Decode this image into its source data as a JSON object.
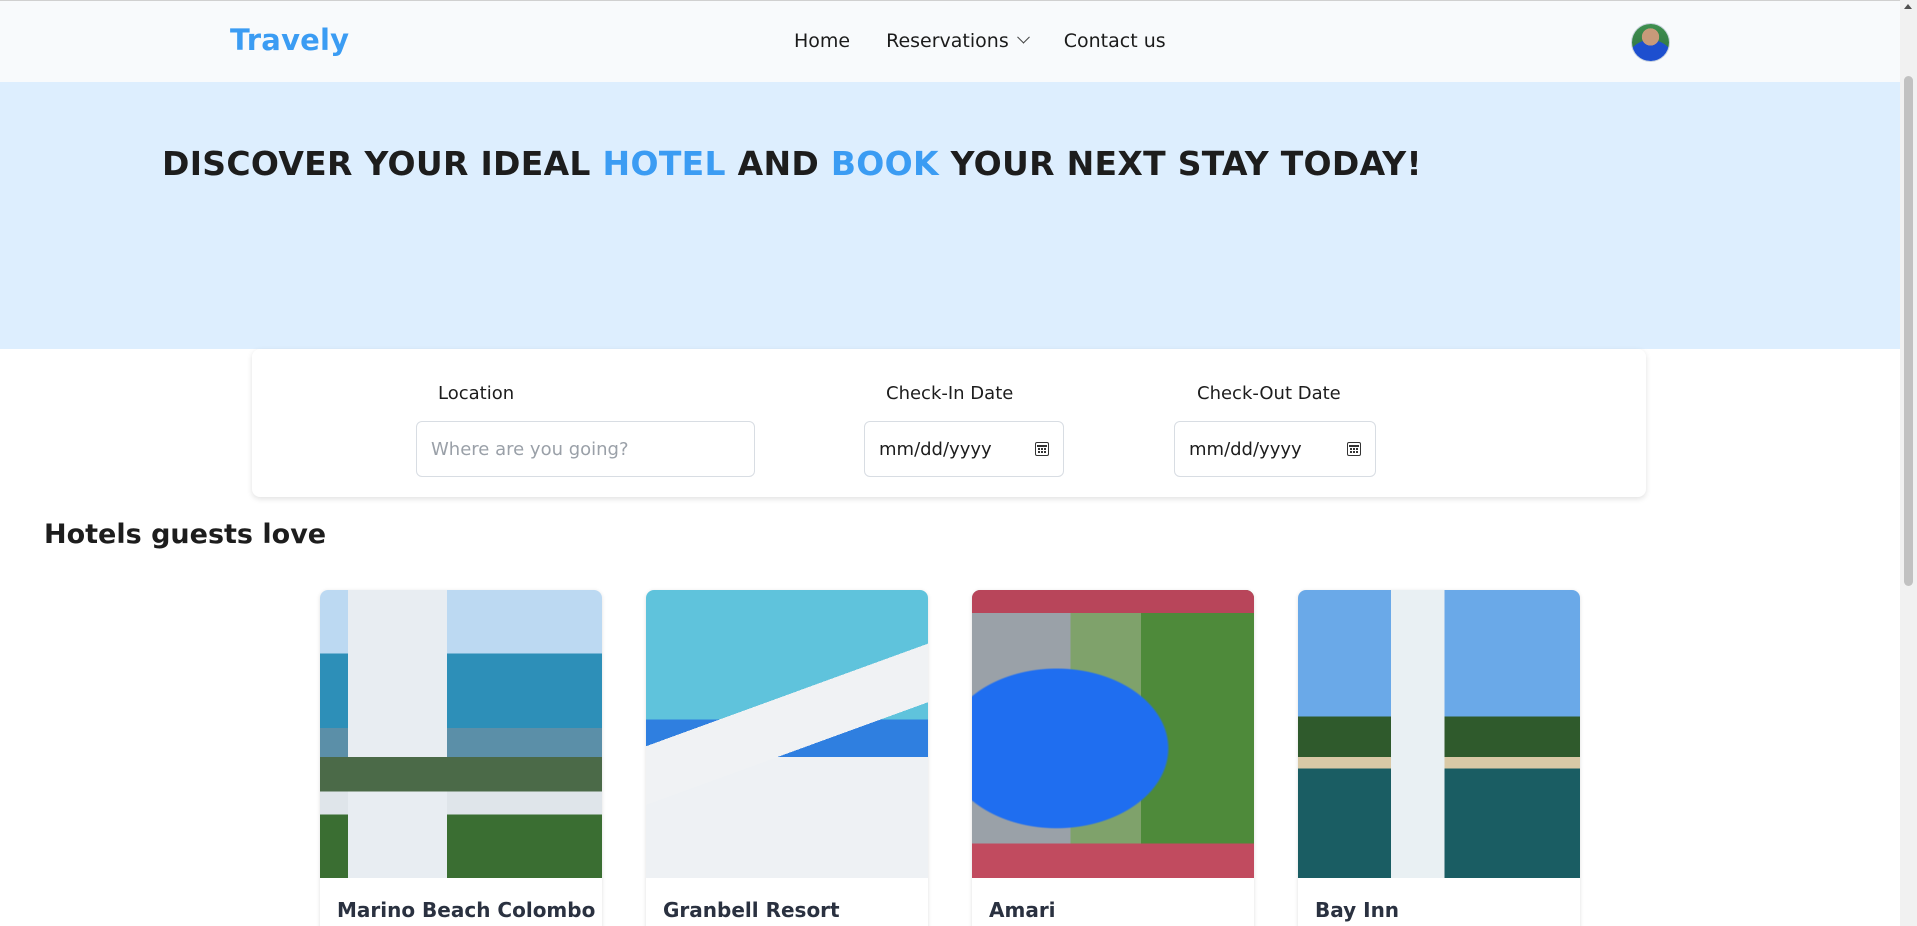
{
  "brand": {
    "logo_text": "Travely",
    "accent_color": "#3b9cf3"
  },
  "nav": {
    "items": [
      {
        "label": "Home"
      },
      {
        "label": "Reservations",
        "icon": "chevron-down-icon"
      },
      {
        "label": "Contact us"
      }
    ],
    "avatar": "user-avatar"
  },
  "hero": {
    "title_part1": "DISCOVER YOUR IDEAL ",
    "title_accent1": "HOTEL",
    "title_part2": " AND ",
    "title_accent2": "BOOK",
    "title_part3": " YOUR NEXT STAY TODAY!",
    "background": "#ddeefe"
  },
  "search": {
    "location_label": "Location",
    "location_placeholder": "Where are you going?",
    "location_value": "",
    "checkin_label": "Check-In Date",
    "checkin_value": "mm/dd/yyyy",
    "checkout_label": "Check-Out Date",
    "checkout_value": "mm/dd/yyyy",
    "date_icon": "calendar-icon"
  },
  "section": {
    "title": "Hotels guests love"
  },
  "hotels": [
    {
      "name": "Marino Beach Colombo"
    },
    {
      "name": "Granbell Resort"
    },
    {
      "name": "Amari"
    },
    {
      "name": "Bay Inn"
    }
  ]
}
